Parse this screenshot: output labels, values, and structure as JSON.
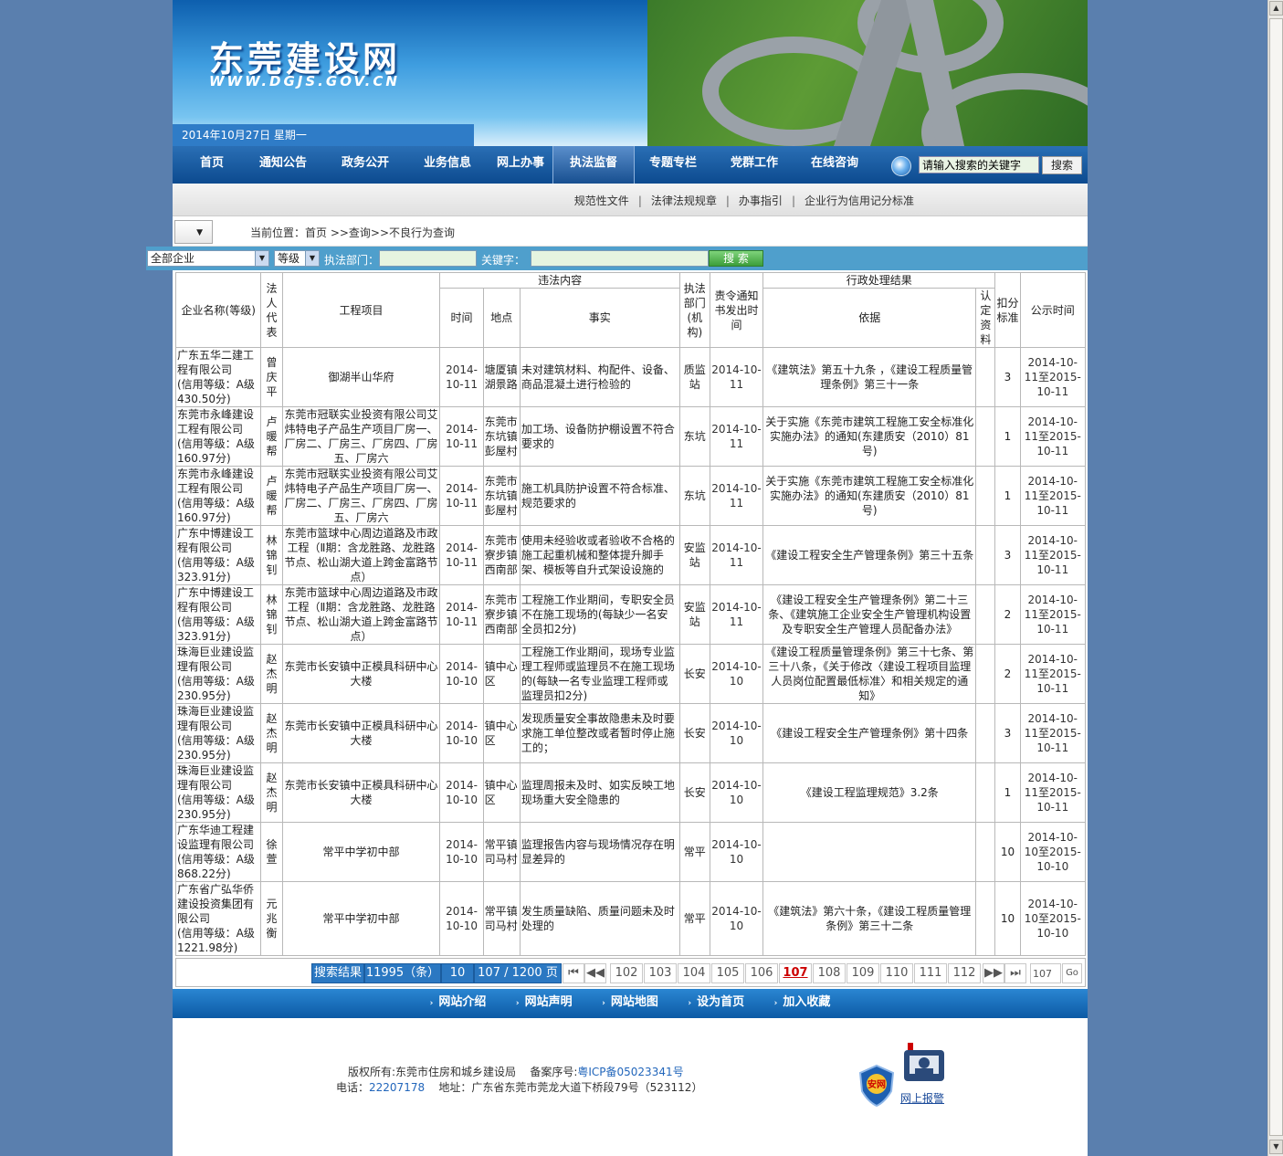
{
  "header": {
    "site_name": "东莞建设网",
    "site_url": "WWW.DGJS.GOV.CN",
    "date": "2014年10月27日  星期一"
  },
  "nav": {
    "items": [
      "首页",
      "通知公告",
      "政务公开",
      "业务信息",
      "网上办事",
      "执法监督",
      "专题专栏",
      "党群工作",
      "在线咨询"
    ],
    "active": "执法监督"
  },
  "search": {
    "placeholder": "请输入搜索的关键字",
    "button": "搜索"
  },
  "subnav": [
    "规范性文件",
    "法律法规规章",
    "办事指引",
    "企业行为信用记分标准"
  ],
  "breadcrumb": "当前位置：首页  >>查询>>不良行为查询",
  "filters": {
    "enterprise_select": "全部企业",
    "level_select": "等级",
    "dept_label": "执法部门：",
    "keyword_label": "关键字：",
    "search_button": "搜 索"
  },
  "table": {
    "headers": {
      "company": "企业名称(等级)",
      "legal": "法人代表",
      "project": "工程项目",
      "violation": "违法内容",
      "time": "时间",
      "place": "地点",
      "fact": "事实",
      "dept": "执法部门(机构)",
      "notice": "责令通知书发出时间",
      "result": "行政处理结果",
      "basis": "依据",
      "confirm": "认定资料",
      "deduct": "扣分标准",
      "publish": "公示时间"
    },
    "rows": [
      {
        "company": "广东五华二建工程有限公司",
        "level": "(信用等级：A级430.50分)",
        "legal": "曾庆平",
        "project": "御湖半山华府",
        "time": "2014-10-11",
        "place": "塘厦镇湖景路",
        "fact": "未对建筑材料、构配件、设备、商品混凝土进行检验的",
        "dept": "质监站",
        "notice": "2014-10-11",
        "basis": "《建筑法》第五十九条 ，《建设工程质量管理条例》第三十一条",
        "confirm": "",
        "deduct": "3",
        "publish": "2014-10-11至2015-10-11"
      },
      {
        "company": "东莞市永峰建设工程有限公司",
        "level": "(信用等级：A级160.97分)",
        "legal": "卢暖帮",
        "project": "东莞市冠联实业投资有限公司艾炜特电子产品生产项目厂房一、厂房二、厂房三、厂房四、厂房五、厂房六",
        "time": "2014-10-11",
        "place": "东莞市东坑镇彭屋村",
        "fact": "加工场、设备防护棚设置不符合要求的",
        "dept": "东坑",
        "notice": "2014-10-11",
        "basis": "关于实施《东莞市建筑工程施工安全标准化实施办法》的通知(东建质安（2010）81号)",
        "confirm": "",
        "deduct": "1",
        "publish": "2014-10-11至2015-10-11"
      },
      {
        "company": "东莞市永峰建设工程有限公司",
        "level": "(信用等级：A级160.97分)",
        "legal": "卢暖帮",
        "project": "东莞市冠联实业投资有限公司艾炜特电子产品生产项目厂房一、厂房二、厂房三、厂房四、厂房五、厂房六",
        "time": "2014-10-11",
        "place": "东莞市东坑镇彭屋村",
        "fact": "施工机具防护设置不符合标准、规范要求的",
        "dept": "东坑",
        "notice": "2014-10-11",
        "basis": "关于实施《东莞市建筑工程施工安全标准化实施办法》的通知(东建质安（2010）81号)",
        "confirm": "",
        "deduct": "1",
        "publish": "2014-10-11至2015-10-11"
      },
      {
        "company": "广东中博建设工程有限公司",
        "level": "(信用等级：A级323.91分)",
        "legal": "林锦钊",
        "project": "东莞市篮球中心周边道路及市政工程（Ⅱ期：含龙胜路、龙胜路节点、松山湖大道上跨金富路节点）",
        "time": "2014-10-11",
        "place": "东莞市寮步镇西南部",
        "fact": "使用未经验收或者验收不合格的施工起重机械和整体提升脚手架、模板等自升式架设设施的",
        "dept": "安监站",
        "notice": "2014-10-11",
        "basis": "《建设工程安全生产管理条例》第三十五条",
        "confirm": "",
        "deduct": "3",
        "publish": "2014-10-11至2015-10-11"
      },
      {
        "company": "广东中博建设工程有限公司",
        "level": "(信用等级：A级323.91分)",
        "legal": "林锦钊",
        "project": "东莞市篮球中心周边道路及市政工程（Ⅱ期：含龙胜路、龙胜路节点、松山湖大道上跨金富路节点）",
        "time": "2014-10-11",
        "place": "东莞市寮步镇西南部",
        "fact": "工程施工作业期间，专职安全员不在施工现场的(每缺少一名安全员扣2分)",
        "dept": "安监站",
        "notice": "2014-10-11",
        "basis": "《建设工程安全生产管理条例》第二十三条、《建筑施工企业安全生产管理机构设置及专职安全生产管理人员配备办法》",
        "confirm": "",
        "deduct": "2",
        "publish": "2014-10-11至2015-10-11"
      },
      {
        "company": "珠海巨业建设监理有限公司",
        "level": "(信用等级：A级230.95分)",
        "legal": "赵杰明",
        "project": "东莞市长安镇中正模具科研中心大楼",
        "time": "2014-10-10",
        "place": "镇中心区",
        "fact": "工程施工作业期间，现场专业监理工程师或监理员不在施工现场的(每缺一名专业监理工程师或监理员扣2分)",
        "dept": "长安",
        "notice": "2014-10-10",
        "basis": "《建设工程质量管理条例》第三十七条、第三十八条，《关于修改〈建设工程项目监理人员岗位配置最低标准〉和相关规定的通知》",
        "confirm": "",
        "deduct": "2",
        "publish": "2014-10-11至2015-10-11"
      },
      {
        "company": "珠海巨业建设监理有限公司",
        "level": "(信用等级：A级230.95分)",
        "legal": "赵杰明",
        "project": "东莞市长安镇中正模具科研中心大楼",
        "time": "2014-10-10",
        "place": "镇中心区",
        "fact": "发现质量安全事故隐患未及时要求施工单位整改或者暂时停止施工的；",
        "dept": "长安",
        "notice": "2014-10-10",
        "basis": "《建设工程安全生产管理条例》第十四条",
        "confirm": "",
        "deduct": "3",
        "publish": "2014-10-11至2015-10-11"
      },
      {
        "company": "珠海巨业建设监理有限公司",
        "level": "(信用等级：A级230.95分)",
        "legal": "赵杰明",
        "project": "东莞市长安镇中正模具科研中心大楼",
        "time": "2014-10-10",
        "place": "镇中心区",
        "fact": "监理周报未及时、如实反映工地现场重大安全隐患的",
        "dept": "长安",
        "notice": "2014-10-10",
        "basis": "《建设工程监理规范》3.2条",
        "confirm": "",
        "deduct": "1",
        "publish": "2014-10-11至2015-10-11"
      },
      {
        "company": "广东华迪工程建设监理有限公司",
        "level": "(信用等级：A级868.22分)",
        "legal": "徐萱",
        "project": "常平中学初中部",
        "time": "2014-10-10",
        "place": "常平镇司马村",
        "fact": "监理报告内容与现场情况存在明显差异的",
        "dept": "常平",
        "notice": "2014-10-10",
        "basis": "",
        "confirm": "",
        "deduct": "10",
        "publish": "2014-10-10至2015-10-10"
      },
      {
        "company": "广东省广弘华侨建设投资集团有限公司",
        "level": "(信用等级：A级1221.98分)",
        "legal": "元兆衡",
        "project": "常平中学初中部",
        "time": "2014-10-10",
        "place": "常平镇司马村",
        "fact": "发生质量缺陷、质量问题未及时处理的",
        "dept": "常平",
        "notice": "2014-10-10",
        "basis": "《建筑法》第六十条，《建设工程质量管理条例》第三十二条",
        "confirm": "",
        "deduct": "10",
        "publish": "2014-10-10至2015-10-10"
      }
    ]
  },
  "pager": {
    "label": "搜索结果",
    "total": "11995（条）",
    "page_size": "10",
    "page_info": "107 / 1200 页",
    "pages": [
      "102",
      "103",
      "104",
      "105",
      "106",
      "107",
      "108",
      "109",
      "110",
      "111",
      "112"
    ],
    "current": "107",
    "jump_value": "107",
    "go": "Go",
    "first_icon": "first-page-icon",
    "prev_icon": "prev-page-icon",
    "next_icon": "next-page-icon",
    "last_icon": "last-page-icon"
  },
  "footer": {
    "links": [
      "网站介绍",
      "网站声明",
      "网站地图",
      "设为首页",
      "加入收藏"
    ],
    "copyright": "版权所有:东莞市住房和城乡建设局",
    "icp_label": "备案序号:",
    "icp": "粤ICP备05023341号",
    "phone_label": "电话：",
    "phone": "22207178",
    "address": "地址：广东省东莞市莞龙大道下桥段79号（523112）",
    "badge_text": "安网",
    "police_label": "网上报警"
  }
}
